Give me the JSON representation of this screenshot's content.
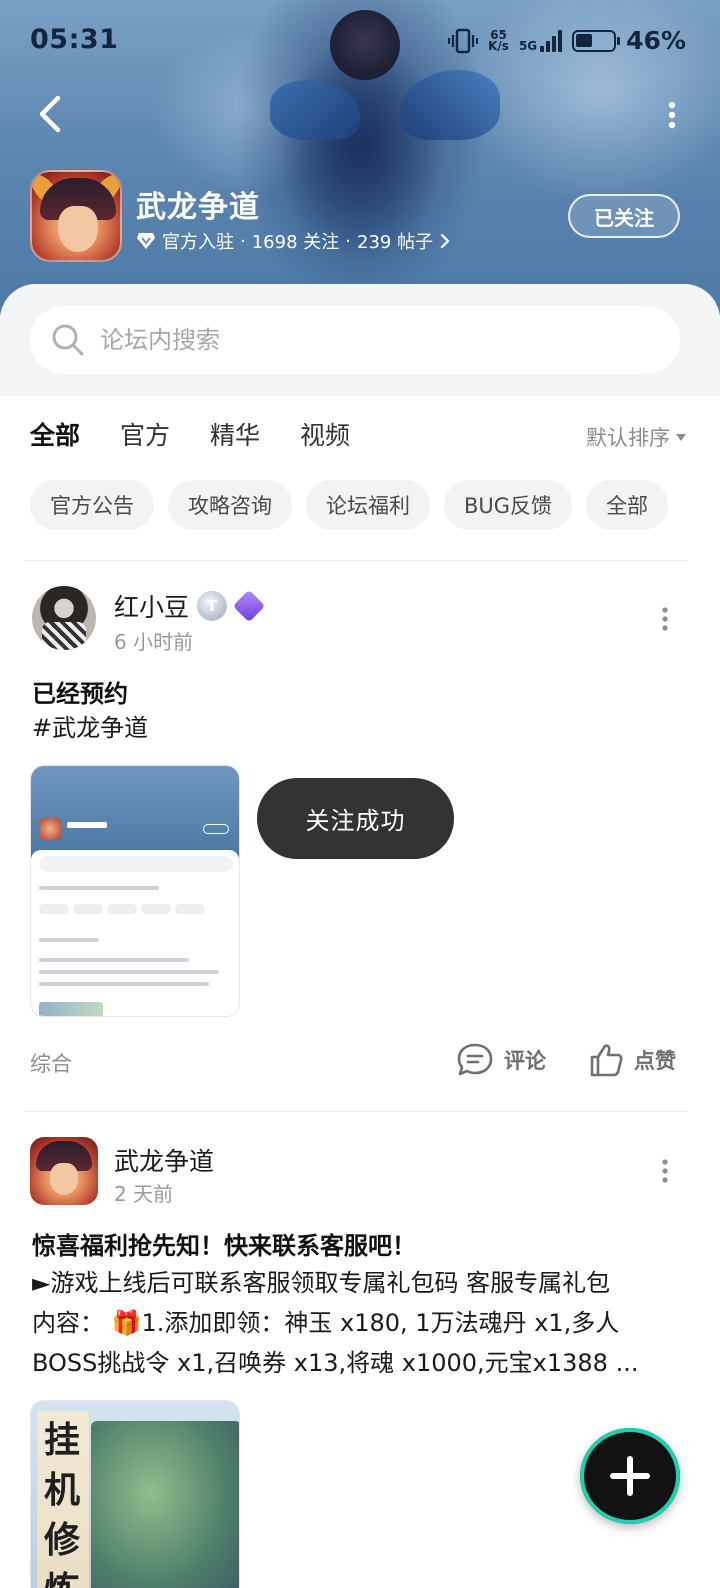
{
  "status_bar": {
    "time": "05:31",
    "network_speed_top": "65",
    "network_speed_bottom": "K/s",
    "network_type": "5G",
    "battery_percent": "46%",
    "battery_level": 0.46
  },
  "header": {
    "app_name": "武龙争道",
    "verified_label": "官方入驻",
    "followers": "1698 关注",
    "posts": "239 帖子",
    "separator": "·",
    "follow_button": "已关注"
  },
  "search": {
    "placeholder": "论坛内搜索"
  },
  "tabs": [
    {
      "label": "全部",
      "active": true
    },
    {
      "label": "官方",
      "active": false
    },
    {
      "label": "精华",
      "active": false
    },
    {
      "label": "视频",
      "active": false
    }
  ],
  "sort": {
    "label": "默认排序"
  },
  "chips": [
    {
      "label": "官方公告"
    },
    {
      "label": "攻略咨询"
    },
    {
      "label": "论坛福利"
    },
    {
      "label": "BUG反馈"
    },
    {
      "label": "全部"
    }
  ],
  "posts": [
    {
      "author": "红小豆",
      "badge_letter": "T",
      "time": "6 小时前",
      "title": "已经预约",
      "body": "#武龙争道",
      "category": "综合",
      "comment_label": "评论",
      "like_label": "点赞"
    },
    {
      "author": "武龙争道",
      "time": "2 天前",
      "title": "惊喜福利抢先知！快来联系客服吧！",
      "body_line1": "►游戏上线后可联系客服领取专属礼包码 客服专属礼包",
      "body_line2": "内容： 🎁1.添加即领：神玉 x180, 1万法魂丹 x1,多人",
      "body_line3": "BOSS挑战令 x1,召唤券 x13,将魂 x1000,元宝x1388 ...",
      "image_calligraphy": "挂机修炼"
    }
  ],
  "toast": {
    "message": "关注成功"
  },
  "colors": {
    "accent": "#1ec9a6",
    "toast_bg": "#333333",
    "chip_bg": "#f2f3f5",
    "banner": "#5d86b0"
  },
  "icons": {
    "back": "back-arrow-icon",
    "more": "more-vertical-icon",
    "search": "search-icon",
    "comment": "comment-icon",
    "like": "thumbs-up-icon",
    "create": "plus-icon"
  }
}
